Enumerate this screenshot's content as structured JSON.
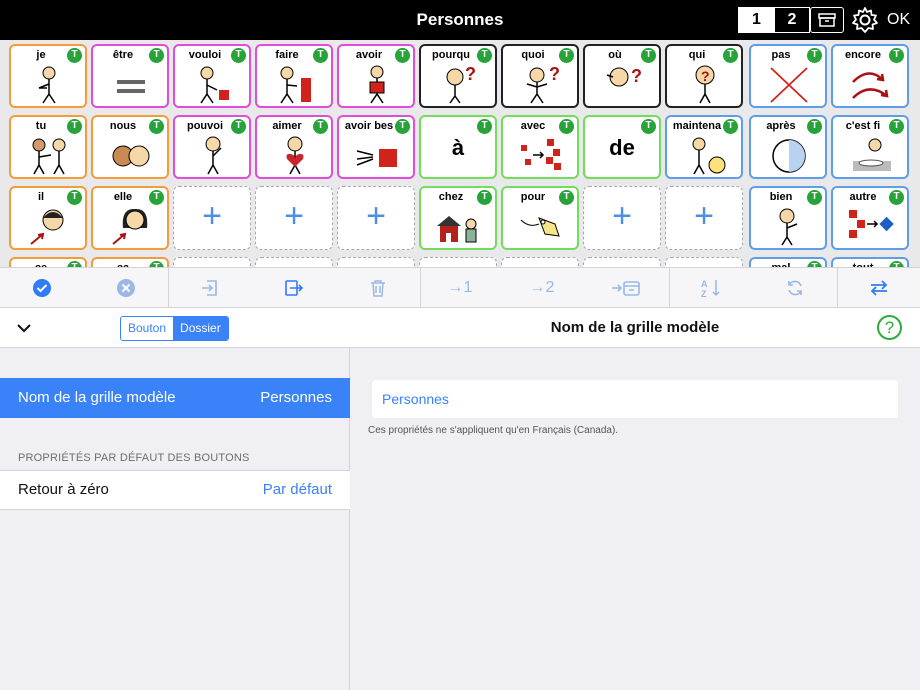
{
  "topbar": {
    "title": "Personnes",
    "page1": "1",
    "page2": "2",
    "ok_label": "OK"
  },
  "grid": {
    "colors": {
      "orange": "#f29c3a",
      "pink": "#e04dd8",
      "black": "#222222",
      "blue": "#5f9ee6",
      "green": "#72dd5b",
      "badge": "#27a33a"
    },
    "badge_label": "T",
    "row1": [
      "je",
      "être",
      "vouloi",
      "faire",
      "avoir",
      "pourqu",
      "quoi",
      "où",
      "qui",
      "pas",
      "encore"
    ],
    "row2": [
      "tu",
      "nous",
      "pouvoi",
      "aimer",
      "avoir bes",
      "à",
      "avec",
      "de",
      "maintena",
      "après",
      "c'est fi"
    ],
    "row3": [
      "il",
      "elle",
      "",
      "",
      "",
      "chez",
      "pour",
      "",
      "",
      "bien",
      "autre"
    ],
    "row4": [
      "ce",
      "ca",
      "",
      "",
      "",
      "",
      "",
      "",
      "",
      "mal",
      "tout"
    ]
  },
  "toolbar": {
    "icons": [
      "check-circle-icon",
      "x-circle-icon",
      "import-icon",
      "copy-icon",
      "trash-icon",
      "move-to-1-icon",
      "move-to-2-icon",
      "move-to-box-icon",
      "sort-az-icon",
      "refresh-icon",
      "swap-icon"
    ],
    "move1_label": "→1",
    "move2_label": "→2"
  },
  "left_panel": {
    "toggle_button": "Bouton",
    "toggle_folder": "Dossier",
    "selected_row_label": "Nom de la grille modèle",
    "selected_row_value": "Personnes",
    "section_header": "PROPRIÉTÉS PAR DÉFAUT DES BOUTONS",
    "reset_label": "Retour à zéro",
    "reset_value": "Par défaut"
  },
  "right_panel": {
    "title": "Nom de la grille modèle",
    "help_label": "?",
    "name_value": "Personnes",
    "note": "Ces propriétés ne s'appliquent qu'en Français (Canada)."
  },
  "accent_color": "#3a82f7"
}
